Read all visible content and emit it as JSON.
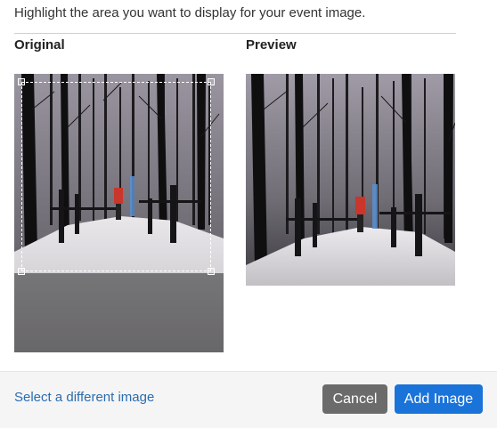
{
  "instructions": "Highlight the area you want to display for your event image.",
  "labels": {
    "original": "Original",
    "preview": "Preview"
  },
  "footer": {
    "select_different": "Select a different image",
    "cancel": "Cancel",
    "add_image": "Add Image"
  },
  "colors": {
    "primary": "#1a73d9",
    "secondary": "#6b6b6b",
    "link": "#2b6cb0"
  }
}
